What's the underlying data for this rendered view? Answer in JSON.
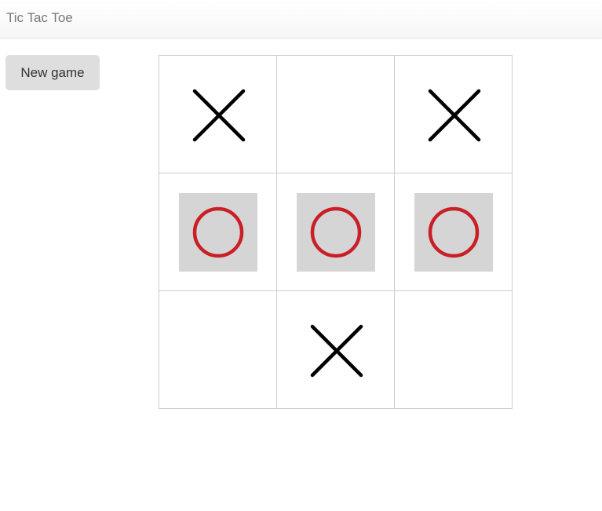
{
  "header": {
    "title": "Tic Tac Toe"
  },
  "controls": {
    "new_game_label": "New game"
  },
  "board": {
    "cells": [
      "X",
      "",
      "X",
      "O",
      "O",
      "O",
      "",
      "X",
      ""
    ],
    "winning_cells": [
      3,
      4,
      5
    ],
    "colors": {
      "x": "#000000",
      "o": "#c91f26",
      "highlight": "#d5d5d5",
      "grid": "#cccccc"
    }
  }
}
